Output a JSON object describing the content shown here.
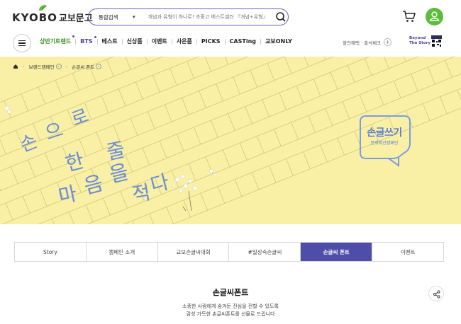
{
  "header": {
    "logo_en": "KYOBO",
    "logo_ko": "교보문고",
    "search_category": "통합검색",
    "search_placeholder": "개념과 유형이 하나로! 초중고 베스트셀러 『개념+유형』",
    "icons": [
      "search-icon",
      "cart-icon",
      "user-icon"
    ]
  },
  "nav": {
    "items": [
      {
        "label": "상반기트렌드",
        "style": "green",
        "dot": true
      },
      {
        "label": "BTS",
        "style": "purple",
        "dot": true
      },
      {
        "label": "베스트",
        "style": "normal",
        "dot": false
      },
      {
        "label": "신상품",
        "style": "normal",
        "dot": false
      },
      {
        "label": "이벤트",
        "style": "normal",
        "dot": false
      },
      {
        "label": "사은품",
        "style": "normal",
        "dot": false
      },
      {
        "label": "PICKS",
        "style": "normal",
        "dot": false
      },
      {
        "label": "CASTing",
        "style": "normal",
        "dot": false
      },
      {
        "label": "교보ONLY",
        "style": "normal",
        "dot": false
      }
    ],
    "right_text": "할인혜택 · 출석체크",
    "plus": "+",
    "beyond": [
      "Beyond",
      "The Story"
    ]
  },
  "breadcrumb": [
    "브랜드캠페인",
    "손글씨 폰트"
  ],
  "banner": {
    "handwriting": [
      {
        "char": "손",
        "line": 1
      },
      {
        "char": "으",
        "line": 1
      },
      {
        "char": "로",
        "line": 1
      },
      {
        "char": "한",
        "line": 1
      },
      {
        "char": "줄",
        "line": 1
      },
      {
        "char": "마",
        "line": 2
      },
      {
        "char": "음",
        "line": 2
      },
      {
        "char": "을",
        "line": 2
      },
      {
        "char": "적",
        "line": 2
      },
      {
        "char": "다",
        "line": 2
      }
    ],
    "badge_title": "손글쓰기",
    "badge_sub": "문화확산캠페인"
  },
  "tabs": [
    {
      "label": "Story",
      "active": false
    },
    {
      "label": "캠페인 소개",
      "active": false
    },
    {
      "label": "교보손글씨대회",
      "active": false
    },
    {
      "label": "#일상속손글씨",
      "active": false
    },
    {
      "label": "손글씨 폰트",
      "active": true
    },
    {
      "label": "이벤트",
      "active": false
    }
  ],
  "section": {
    "title": "손글씨폰트",
    "desc_line1": "소중한 사람에게 숨겨둔 진심을 전할 수 있도록",
    "desc_line2": "감성 가득한 손글씨폰트를 선물로 드립니다"
  },
  "colors": {
    "brand_green": "#5cbd3a",
    "accent_purple": "#4e4ea8",
    "banner_yellow": "#f9f0a6",
    "handwriting_blue": "#6b8ed6"
  }
}
